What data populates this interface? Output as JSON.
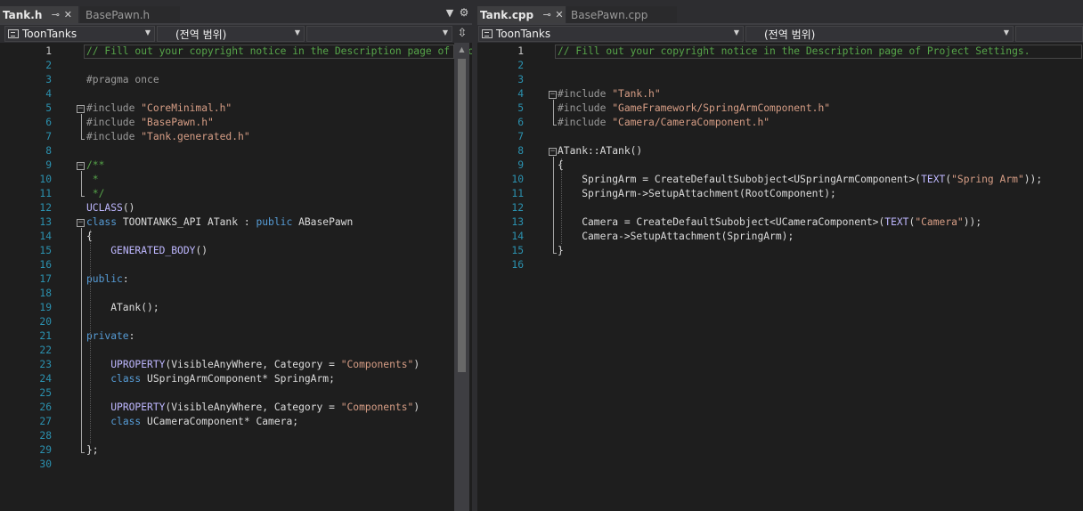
{
  "left": {
    "tabs": [
      {
        "label": "Tank.h",
        "active": true
      },
      {
        "label": "BasePawn.h",
        "active": false
      }
    ],
    "nav": {
      "project": "ToonTanks",
      "scope": "(전역 범위)",
      "member": ""
    },
    "current_line": 1,
    "lines": [
      [
        [
          "cmt",
          "// Fill out your copyright notice in the Description page of Project Settings."
        ]
      ],
      [],
      [
        [
          "pp",
          "#pragma once"
        ]
      ],
      [],
      [
        [
          "pp",
          "#include "
        ],
        [
          "str",
          "\"CoreMinimal.h\""
        ]
      ],
      [
        [
          "pp",
          "#include "
        ],
        [
          "str",
          "\"BasePawn.h\""
        ]
      ],
      [
        [
          "pp",
          "#include "
        ],
        [
          "str",
          "\"Tank.generated.h\""
        ]
      ],
      [],
      [
        [
          "cmt",
          "/**"
        ]
      ],
      [
        [
          "cmt",
          " *"
        ]
      ],
      [
        [
          "cmt",
          " */"
        ]
      ],
      [
        [
          "mac",
          "UCLASS"
        ],
        [
          "plain",
          "()"
        ]
      ],
      [
        [
          "kw",
          "class "
        ],
        [
          "plain",
          "TOONTANKS_API ATank : "
        ],
        [
          "kw",
          "public "
        ],
        [
          "plain",
          "ABasePawn"
        ]
      ],
      [
        [
          "plain",
          "{"
        ]
      ],
      [
        [
          "plain",
          "    "
        ],
        [
          "mac",
          "GENERATED_BODY"
        ],
        [
          "plain",
          "()"
        ]
      ],
      [],
      [
        [
          "kw",
          "public"
        ],
        [
          "plain",
          ":"
        ]
      ],
      [],
      [
        [
          "plain",
          "    ATank();"
        ]
      ],
      [],
      [
        [
          "kw",
          "private"
        ],
        [
          "plain",
          ":"
        ]
      ],
      [],
      [
        [
          "plain",
          "    "
        ],
        [
          "mac",
          "UPROPERTY"
        ],
        [
          "plain",
          "(VisibleAnyWhere, Category = "
        ],
        [
          "str",
          "\"Components\""
        ],
        [
          "plain",
          ")"
        ]
      ],
      [
        [
          "plain",
          "    "
        ],
        [
          "kw",
          "class "
        ],
        [
          "plain",
          "USpringArmComponent* SpringArm;"
        ]
      ],
      [],
      [
        [
          "plain",
          "    "
        ],
        [
          "mac",
          "UPROPERTY"
        ],
        [
          "plain",
          "(VisibleAnyWhere, Category = "
        ],
        [
          "str",
          "\"Components\""
        ],
        [
          "plain",
          ")"
        ]
      ],
      [
        [
          "plain",
          "    "
        ],
        [
          "kw",
          "class "
        ],
        [
          "plain",
          "UCameraComponent* Camera;"
        ]
      ],
      [],
      [
        [
          "plain",
          "};"
        ]
      ],
      []
    ]
  },
  "right": {
    "tabs": [
      {
        "label": "Tank.cpp",
        "active": true
      },
      {
        "label": "BasePawn.cpp",
        "active": false
      }
    ],
    "nav": {
      "project": "ToonTanks",
      "scope": "(전역 범위)",
      "member": ""
    },
    "current_line": 1,
    "lines": [
      [
        [
          "cmt",
          "// Fill out your copyright notice in the Description page of Project Settings."
        ]
      ],
      [],
      [],
      [
        [
          "pp",
          "#include "
        ],
        [
          "str",
          "\"Tank.h\""
        ]
      ],
      [
        [
          "pp",
          "#include "
        ],
        [
          "str",
          "\"GameFramework/SpringArmComponent.h\""
        ]
      ],
      [
        [
          "pp",
          "#include "
        ],
        [
          "str",
          "\"Camera/CameraComponent.h\""
        ]
      ],
      [],
      [
        [
          "plain",
          "ATank::ATank()"
        ]
      ],
      [
        [
          "plain",
          "{"
        ]
      ],
      [
        [
          "plain",
          "    SpringArm = "
        ],
        [
          "plain",
          "CreateDefaultSubobject<USpringArmComponent>("
        ],
        [
          "mac",
          "TEXT"
        ],
        [
          "plain",
          "("
        ],
        [
          "str",
          "\"Spring Arm\""
        ],
        [
          "plain",
          "));"
        ]
      ],
      [
        [
          "plain",
          "    SpringArm->SetupAttachment(RootComponent);"
        ]
      ],
      [],
      [
        [
          "plain",
          "    Camera = "
        ],
        [
          "plain",
          "CreateDefaultSubobject<UCameraComponent>("
        ],
        [
          "mac",
          "TEXT"
        ],
        [
          "plain",
          "("
        ],
        [
          "str",
          "\"Camera\""
        ],
        [
          "plain",
          "));"
        ]
      ],
      [
        [
          "plain",
          "    Camera->SetupAttachment(SpringArm);"
        ]
      ],
      [
        [
          "plain",
          "}"
        ]
      ],
      []
    ]
  },
  "icons": {
    "pin": "pin-icon",
    "close": "close-icon",
    "dropdown": "chevron-down-icon",
    "settings": "gear-icon",
    "split": "split-editor-icon",
    "project": "project-icon"
  },
  "colors": {
    "background": "#1e1e1e",
    "keyword": "#569cd6",
    "string": "#d69d85",
    "comment": "#57a64a",
    "preprocessor": "#9b9b9b",
    "line_number": "#2b91af"
  }
}
